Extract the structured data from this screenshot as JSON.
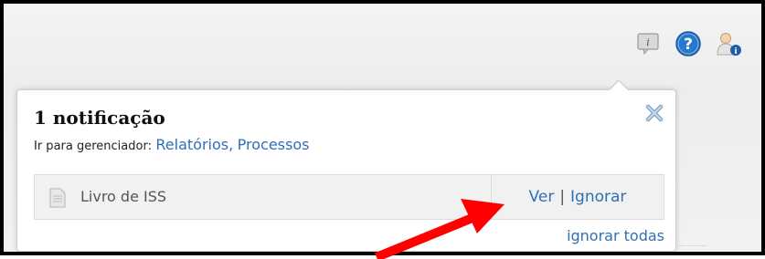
{
  "header_icons": [
    {
      "name": "info-icon"
    },
    {
      "name": "help-icon"
    },
    {
      "name": "user-info-icon"
    }
  ],
  "popup": {
    "title": "1 notificação",
    "manager_label": "Ir para gerenciador:",
    "manager_links": [
      "Relatórios",
      "Processos"
    ],
    "manager_separator": ",",
    "close_icon": "close-x-icon",
    "notification": {
      "text": "Livro de ISS",
      "view_label": "Ver",
      "separator": "|",
      "ignore_label": "Ignorar"
    },
    "ignore_all_label": "ignorar todas"
  },
  "colors": {
    "link": "#2f6fb5",
    "help_blue": "#2a78c9",
    "arrow": "#ff0000",
    "border": "#000000"
  }
}
